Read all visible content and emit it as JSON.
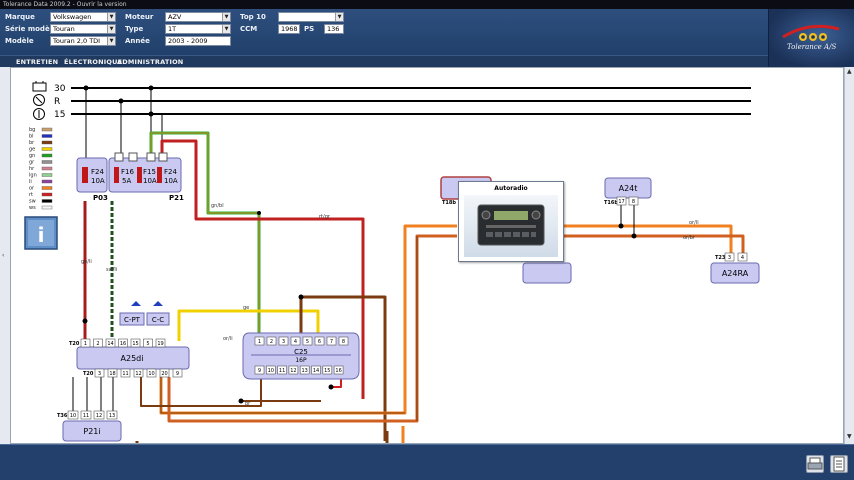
{
  "window": {
    "title": "Tolerance Data 2009.2 - Ouvrir la version"
  },
  "header": {
    "marque_label": "Marque",
    "marque_value": "Volkswagen",
    "serie_label": "Série modèle",
    "serie_value": "Touran",
    "modele_label": "Modèle",
    "modele_value": "Touran 2,0 TDI",
    "moteur_label": "Moteur",
    "moteur_value": "AZV",
    "type_label": "Type",
    "type_value": "1T",
    "annee_label": "Année",
    "annee_value": "2003 - 2009",
    "top10_label": "Top 10",
    "top10_value": "",
    "ccm_label": "CCM",
    "ccm_value": "1968",
    "ps_label": "PS",
    "ps_value": "136",
    "logo_text": "Tolerance A/S"
  },
  "menu": {
    "items": [
      "ENTRETIEN",
      "ÉLECTRONIQUE",
      "ADMINISTRATION"
    ]
  },
  "legend": {
    "codes": [
      "bg",
      "bl",
      "br",
      "ge",
      "gn",
      "gr",
      "hr",
      "lgn",
      "li",
      "or",
      "rt",
      "sw",
      "ws"
    ],
    "colors": [
      "#c8a070",
      "#2030c0",
      "#7a3b10",
      "#f0d000",
      "#20a020",
      "#909090",
      "#d08090",
      "#90d090",
      "#9040a0",
      "#f08020",
      "#d02020",
      "#000000",
      "#f4f4f4"
    ]
  },
  "diagram": {
    "rails": [
      "30",
      "R",
      "15"
    ],
    "fuses": {
      "f24": "F24",
      "f24a": "10A",
      "f16": "F16",
      "f16a": "5A",
      "f15": "F15",
      "f15a": "10A",
      "f24b": "F24",
      "f24ba": "10A",
      "p03": "P03",
      "p21": "P21"
    },
    "components": {
      "a25di": "A25di",
      "c25": "C25",
      "c25sub": "16P",
      "a24t": "A24t",
      "a24ra": "A24RA",
      "p21i": "P21i",
      "cpt": "C-PT",
      "cc": "C-C",
      "t20a": "T20",
      "t20b": "T20",
      "t36": "T36",
      "t23": "T23",
      "t18b": "T18b",
      "t16b": "T16b"
    },
    "wire_labels": {
      "gnbl": "gn/bl",
      "rtgr": "rt/gr",
      "ge": "ge",
      "orli": "or/li",
      "br": "br",
      "orli2": "or/li",
      "orbr": "or/br",
      "swli": "sw/li",
      "geli": "ge/li"
    },
    "pins": {
      "a25_top": [
        "1",
        "2",
        "14",
        "16",
        "15",
        "5",
        "19"
      ],
      "a25_bot": [
        "3",
        "18",
        "11",
        "12",
        "10",
        "20",
        "9"
      ],
      "c25_top": [
        "1",
        "2",
        "3",
        "4",
        "5",
        "6",
        "7",
        "8"
      ],
      "c25_bot": [
        "9",
        "10",
        "11",
        "12",
        "13",
        "14",
        "15",
        "16"
      ],
      "p21i": [
        "10",
        "11",
        "12",
        "13"
      ],
      "a24t": [
        "17",
        "8"
      ],
      "a24ra": [
        "3",
        "4"
      ]
    }
  },
  "popup": {
    "title": "Autoradio"
  }
}
